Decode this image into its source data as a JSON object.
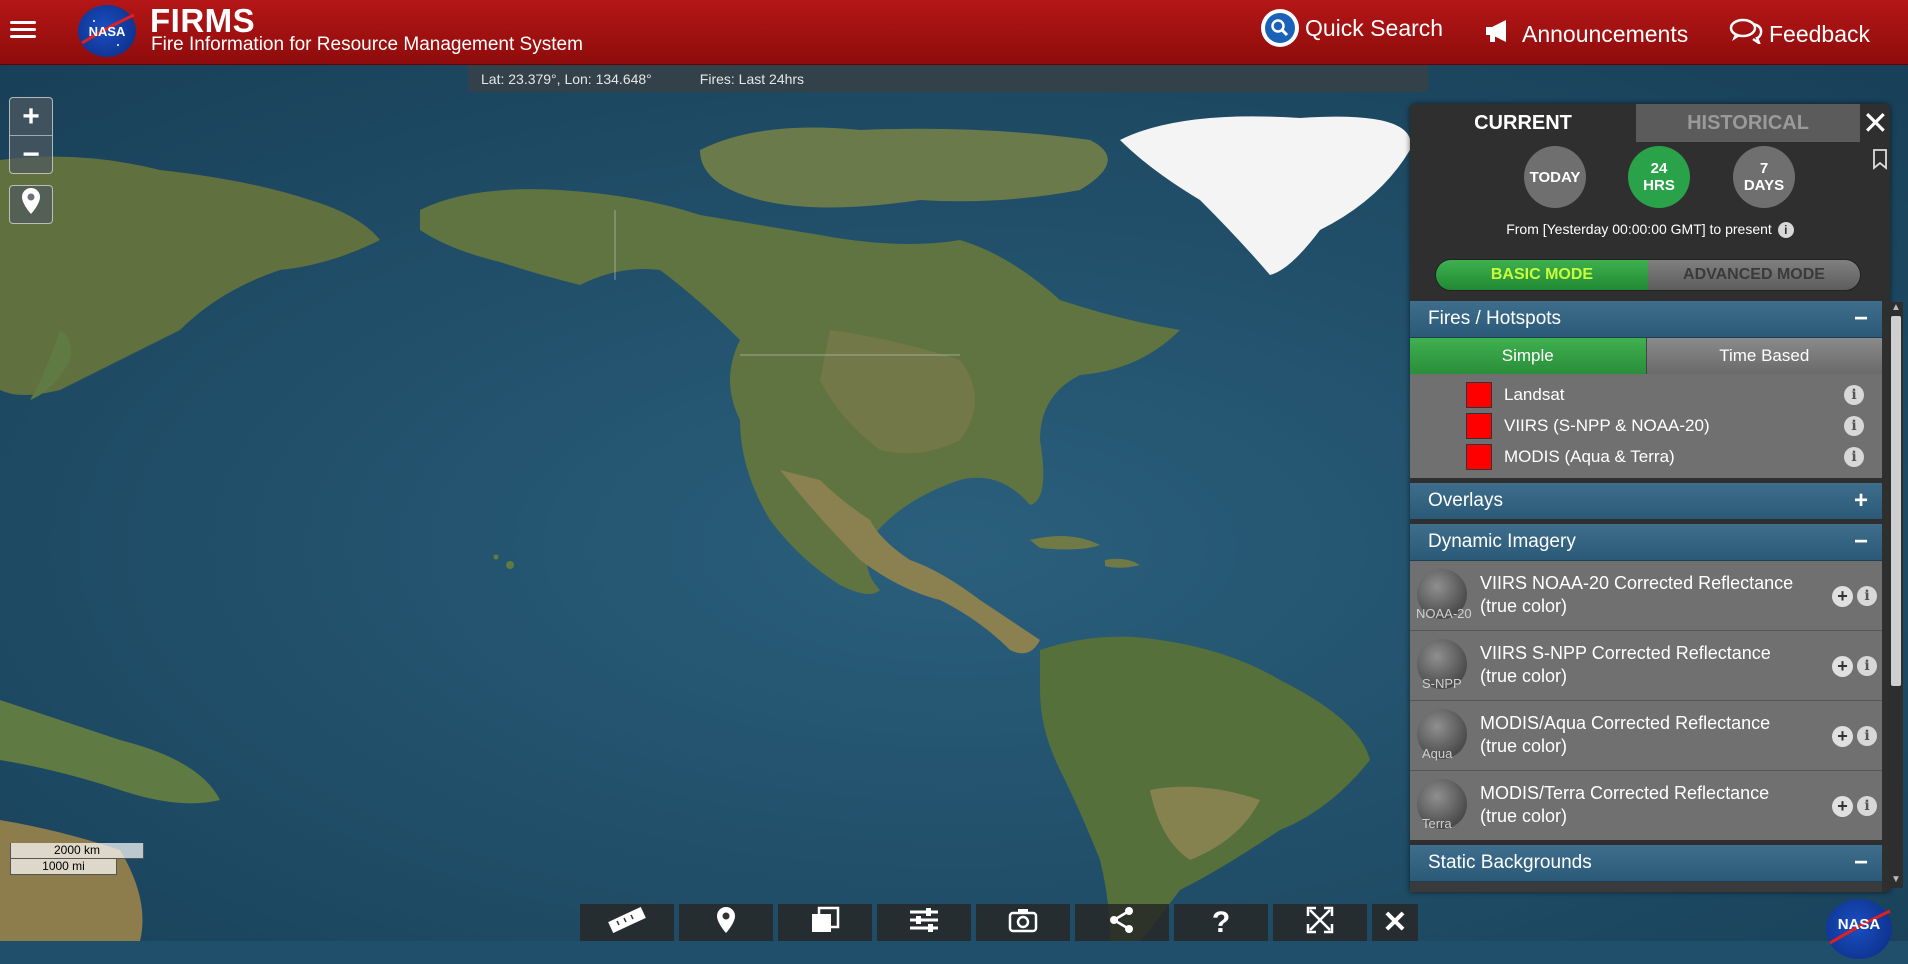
{
  "header": {
    "app_title": "FIRMS",
    "app_subtitle": "Fire Information for Resource Management System",
    "logo_text": "NASA",
    "quick_search": "Quick Search",
    "announcements": "Announcements",
    "feedback": "Feedback"
  },
  "map": {
    "coordinates": "Lat: 23.379°, Lon: 134.648°",
    "fires_period": "Fires: Last 24hrs",
    "scale_km": "2000 km",
    "scale_mi": "1000 mi"
  },
  "panel": {
    "tabs": [
      "CURRENT",
      "HISTORICAL"
    ],
    "time_buttons": [
      {
        "label": "TODAY",
        "active": false
      },
      {
        "label": "24\nHRS",
        "active": true
      },
      {
        "label": "7\nDAYS",
        "active": false
      }
    ],
    "time_24": [
      "24",
      "HRS"
    ],
    "time_7": [
      "7",
      "DAYS"
    ],
    "from_text": "From [Yesterday 00:00:00 GMT] to present",
    "mode_basic": "BASIC MODE",
    "mode_advanced": "ADVANCED MODE",
    "sections": {
      "fires": {
        "title": "Fires / Hotspots",
        "toggle": "−",
        "subtabs": [
          "Simple",
          "Time Based"
        ],
        "layers": [
          "Landsat",
          "VIIRS (S-NPP & NOAA-20)",
          "MODIS (Aqua & Terra)"
        ]
      },
      "overlays": {
        "title": "Overlays",
        "toggle": "+"
      },
      "dynamic": {
        "title": "Dynamic Imagery",
        "toggle": "−",
        "items": [
          {
            "thumb": "NOAA-20",
            "title": "VIIRS NOAA-20 Corrected Reflectance (true color)"
          },
          {
            "thumb": "S-NPP",
            "title": "VIIRS S-NPP Corrected Reflectance (true color)"
          },
          {
            "thumb": "Aqua",
            "title": "MODIS/Aqua Corrected Reflectance (true color)"
          },
          {
            "thumb": "Terra",
            "title": "MODIS/Terra Corrected Reflectance (true color)"
          }
        ]
      },
      "static": {
        "title": "Static Backgrounds",
        "toggle": "−"
      }
    }
  },
  "toolbar": {
    "icons": [
      "ruler-icon",
      "location-pin-icon",
      "layers-copy-icon",
      "sliders-icon",
      "camera-icon",
      "share-icon",
      "help-icon",
      "fullscreen-icon",
      "close-icon"
    ],
    "help_label": "?"
  },
  "colors": {
    "header_red": "#a81212",
    "accent_green": "#2aa24a",
    "section_blue": "#3e6e8c",
    "fire_red": "#ff0000"
  }
}
